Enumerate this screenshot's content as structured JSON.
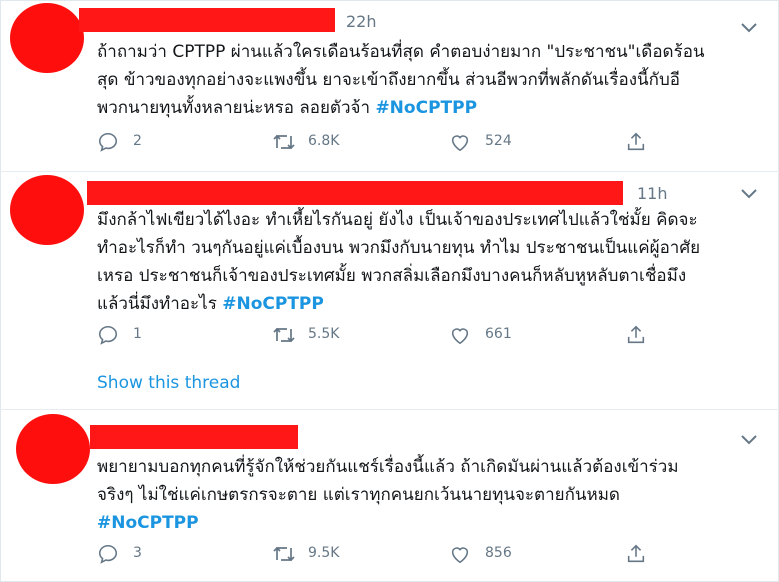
{
  "tweets": [
    {
      "time": "22h",
      "lines": [
        "ถ้าถามว่า CPTPP ผ่านแล้วใครเดือนร้อนที่สุด คำตอบง่ายมาก \"ประชาชน\"เดือดร้อน",
        "สุด ข้าวของทุกอย่างจะแพงขึ้น ยาจะเข้าถึงยากขึ้น ส่วนอีพวกที่พลักดันเรื่องนี้กับอี",
        "พวกนายทุนทั้งหลายน่ะหรอ ลอยตัวจ้า"
      ],
      "hashtag": "#NoCPTPP",
      "replies": "2",
      "retweets": "6.8K",
      "likes": "524"
    },
    {
      "time": "11h",
      "lines": [
        "มึงกล้าไฟเขียวได้ไงอะ ทำเหี้ยไรกันอยู่ ยังไง เป็นเจ้าของประเทศไปแล้วใช่มั้ย คิดจะ",
        "ทำอะไรก็ทำ วนๆกันอยู่แค่เบื้องบน พวกมึงกับนายทุน ทำไม ประชาชนเป็นแค่ผู้อาศัย",
        "เหรอ ประชาชนก็เจ้าของประเทศมั้ย พวกสลิ่มเลือกมึงบางคนก็หลับหูหลับตาเชื่อมึง",
        "แล้วนี่มึงทำอะไร"
      ],
      "hashtag": "#NoCPTPP",
      "replies": "1",
      "retweets": "5.5K",
      "likes": "661",
      "show_thread": "Show this thread"
    },
    {
      "time": "",
      "lines": [
        "พยายามบอกทุกคนที่รู้จักให้ช่วยกันแชร์เรื่องนี้แล้ว ถ้าเกิดมันผ่านแล้วต้องเข้าร่วม",
        "จริงๆ ไม่ใช่แค่เกษตรกรจะตาย แต่เราทุกคนยกเว้นนายทุนจะตายกันหมด",
        ""
      ],
      "hashtag": "#NoCPTPP",
      "replies": "3",
      "retweets": "9.5K",
      "likes": "856"
    }
  ],
  "icons": {
    "reply": "reply-icon",
    "retweet": "retweet-icon",
    "like": "like-icon",
    "share": "share-icon",
    "more": "chevron-down-icon"
  },
  "colors": {
    "hashtag": "#1b95e0",
    "secondary_text": "#657786",
    "redaction": "#ff1616",
    "divider": "#e6ecf0"
  }
}
